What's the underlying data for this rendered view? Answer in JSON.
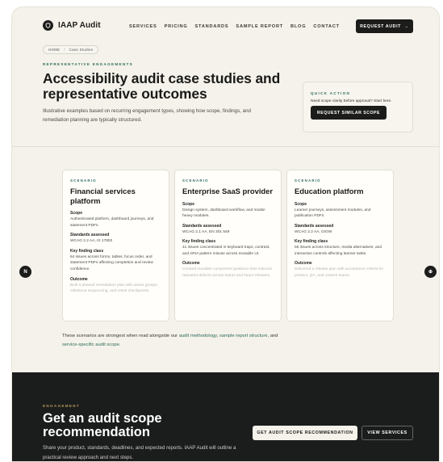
{
  "nav": {
    "brand": "IAAP Audit",
    "links": [
      "SERVICES",
      "PRICING",
      "STANDARDS",
      "SAMPLE REPORT",
      "BLOG",
      "CONTACT"
    ],
    "cta": "REQUEST AUDIT",
    "cta_arrow": "→"
  },
  "breadcrumb": {
    "home": "HOME",
    "sep": "/",
    "current": "Case Studies"
  },
  "hero": {
    "eyebrow": "REPRESENTATIVE ENGAGEMENTS",
    "title": "Accessibility audit case studies and representative outcomes",
    "subtitle": "Illustrative examples based on recurring engagement types, showing how scope, findings, and remediation planning are typically structured."
  },
  "quick_action": {
    "eyebrow": "QUICK ACTION",
    "text": "Need scope clarity before approval? Start here.",
    "button": "REQUEST SIMILAR SCOPE"
  },
  "field_labels": {
    "scope": "Scope",
    "standards": "Standards assessed",
    "finding": "Key finding class",
    "outcome": "Outcome"
  },
  "cards": [
    {
      "eyebrow": "SCENARIO",
      "title": "Financial services platform",
      "scope": "Authenticated platform, dashboard journeys, and statement PDFs.",
      "standards": "WCAG 2.2 AA, IS 17802",
      "finding": "64 issues across forms, tables, focus order, and statement PDFs affecting completion and review confidence.",
      "outcome": "Built a phased remediation plan with owner groups, milestone sequencing, and retest checkpoints."
    },
    {
      "eyebrow": "SCENARIO",
      "title": "Enterprise SaaS provider",
      "scope": "Design system, dashboard workflow, and modal-heavy modules.",
      "standards": "WCAG 2.1 AA, EN 301 549",
      "finding": "41 issues concentrated in keyboard traps, contrast, and ARIA pattern misuse across reusable UI.",
      "outcome": "Created reusable component guidance that reduced repeated defects across teams and future releases."
    },
    {
      "eyebrow": "SCENARIO",
      "title": "Education platform",
      "scope": "Learner journeys, assessment modules, and publication PDFs.",
      "standards": "WCAG 2.2 AA, GIGW",
      "finding": "55 issues across structure, media alternatives, and interactive controls affecting learner tasks.",
      "outcome": "Delivered a release plan with acceptance criteria for product, QA, and content teams."
    }
  ],
  "arrows": {
    "prev": "N",
    "next": "⊕"
  },
  "footnote": {
    "before": "These scenarios are strongest when read alongside our ",
    "link1": "audit methodology",
    "mid1": ", ",
    "link2": "sample report structure",
    "mid2": ", and ",
    "link3": "service-specific audit scope",
    "after": "."
  },
  "cta": {
    "eyebrow": "ENGAGEMENT",
    "title": "Get an audit scope recommendation",
    "subtitle": "Share your product, standards, deadlines, and expected reports. IAAP Audit will outline a practical review approach and next steps.",
    "primary": "GET AUDIT SCOPE RECOMMENDATION",
    "secondary": "VIEW SERVICES"
  },
  "colors": {
    "accent": "#2e6b5e",
    "dark": "#1c1c1a",
    "background": "#f4f2ea"
  }
}
